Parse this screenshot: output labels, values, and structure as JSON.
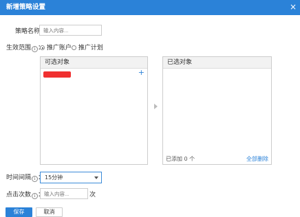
{
  "dialog": {
    "title": "新增策略设置",
    "close_icon": "×"
  },
  "strategy_name": {
    "label": "策略名称：",
    "placeholder": "输入内容..."
  },
  "scope": {
    "label": "生效范围",
    "options": [
      {
        "label": "推广账户",
        "checked": true
      },
      {
        "label": "推广计划",
        "checked": false
      }
    ]
  },
  "available_panel": {
    "title": "可选对象",
    "add_icon": "+"
  },
  "selected_panel": {
    "title": "已选对象",
    "added_count": "已添加 0 个",
    "delete_all": "全部删除"
  },
  "interval": {
    "label": "时间间隔",
    "value": "15分钟"
  },
  "clicks": {
    "label": "点击次数",
    "placeholder": "输入内容...",
    "unit": "次"
  },
  "buttons": {
    "save": "保存",
    "cancel": "取消"
  },
  "info_icon": "i",
  "colors": {
    "title_bar": "#2b82d8",
    "accent": "#2b82d8",
    "redacted": "#f03030"
  }
}
